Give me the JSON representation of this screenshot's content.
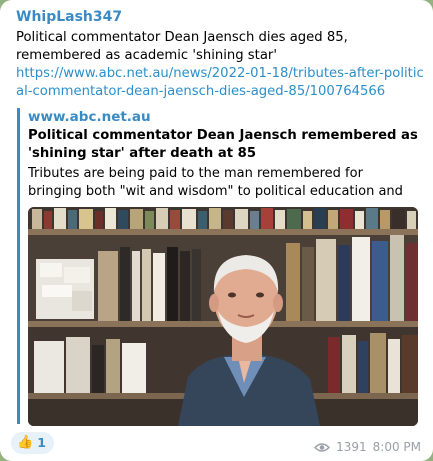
{
  "message": {
    "sender": "WhipLash347",
    "text": "Political commentator Dean Jaensch dies aged 85, remembered as academic 'shining star'",
    "link": "https://www.abc.net.au/news/2022-01-18/tributes-after-political-commentator-dean-jaensch-dies-aged-85/100764566"
  },
  "preview": {
    "site": "www.abc.net.au",
    "title": "Political commentator Dean Jaensch remembered as 'shining star' after death at 85",
    "description": "Tributes are being paid to the man remembered for bringing both \"wit and wisdom\" to political education and electoral analysis in …"
  },
  "reaction": {
    "emoji": "👍",
    "count": "1"
  },
  "meta": {
    "views": "1391",
    "time": "8:00 PM"
  },
  "colors": {
    "accent": "#3a8bc4",
    "link": "#2c8fc9",
    "reaction_bg": "#e6f1f8",
    "meta": "#9aa0a6"
  },
  "icons": {
    "views": "eye-icon"
  }
}
